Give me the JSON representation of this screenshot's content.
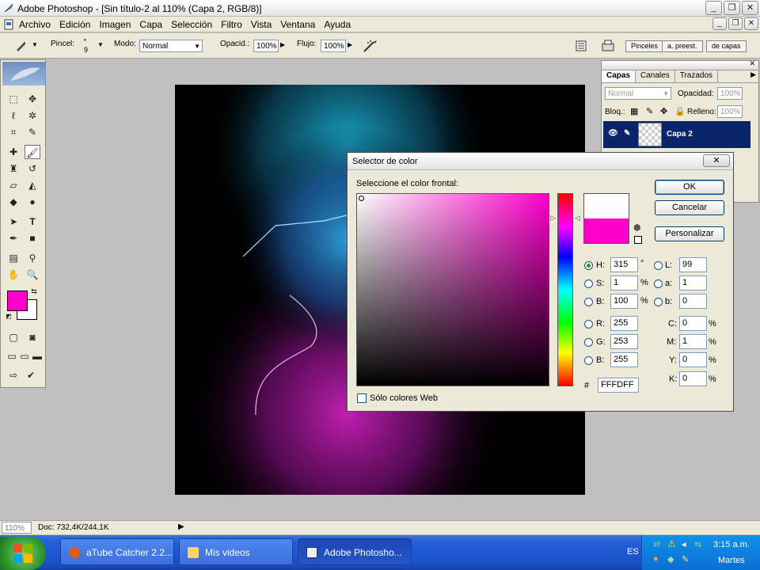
{
  "window": {
    "title": "Adobe Photoshop - [Sin título-2 al 110% (Capa 2, RGB/8)]"
  },
  "menu": {
    "items": [
      "Archivo",
      "Edición",
      "Imagen",
      "Capa",
      "Selección",
      "Filtro",
      "Vista",
      "Ventana",
      "Ayuda"
    ]
  },
  "options": {
    "pincel_label": "Pincel:",
    "brush_size": "9",
    "modo_label": "Modo:",
    "modo_value": "Normal",
    "opacidad_label": "Opacid.:",
    "opacidad_value": "100%",
    "flujo_label": "Flujo:",
    "flujo_value": "100%",
    "dock_tabs": [
      "Pinceles",
      "a. preest.",
      "de capas"
    ]
  },
  "layers_panel": {
    "tabs": [
      "Capas",
      "Canales",
      "Trazados"
    ],
    "blend_mode": "Normal",
    "opacity_label": "Opacidad:",
    "opacity_value": "100%",
    "lock_label": "Bloq.:",
    "fill_label": "Relleno:",
    "fill_value": "100%",
    "layer_name": "Capa 2"
  },
  "dialog": {
    "title": "Selector de color",
    "prompt": "Seleccione el color frontal:",
    "buttons": {
      "ok": "OK",
      "cancel": "Cancelar",
      "custom": "Personalizar"
    },
    "hsb": {
      "h": {
        "label": "H:",
        "value": "315",
        "unit": "°"
      },
      "s": {
        "label": "S:",
        "value": "1",
        "unit": "%"
      },
      "b": {
        "label": "B:",
        "value": "100",
        "unit": "%"
      }
    },
    "lab": {
      "l": {
        "label": "L:",
        "value": "99"
      },
      "a": {
        "label": "a:",
        "value": "1"
      },
      "b": {
        "label": "b:",
        "value": "0"
      }
    },
    "rgb": {
      "r": {
        "label": "R:",
        "value": "255"
      },
      "g": {
        "label": "G:",
        "value": "253"
      },
      "b": {
        "label": "B:",
        "value": "255"
      }
    },
    "cmyk": {
      "c": {
        "label": "C:",
        "value": "0",
        "unit": "%"
      },
      "m": {
        "label": "M:",
        "value": "1",
        "unit": "%"
      },
      "y": {
        "label": "Y:",
        "value": "0",
        "unit": "%"
      },
      "k": {
        "label": "K:",
        "value": "0",
        "unit": "%"
      }
    },
    "hex_label": "#",
    "hex_value": "FFFDFF",
    "web_only_label": "Sólo colores Web",
    "new_color": "#fffdff",
    "current_color": "#ff00cc"
  },
  "statusbar": {
    "zoom": "110%",
    "doc": "Doc: 732,4K/244,1K"
  },
  "taskbar": {
    "tasks": [
      "aTube Catcher 2.2...",
      "Mis videos",
      "Adobe Photosho..."
    ],
    "lang": "ES",
    "time": "3:15 a.m.",
    "day": "Martes"
  },
  "colors": {
    "foreground": "#ff00cc",
    "background": "#ffffff",
    "selection": "#0a246a"
  }
}
